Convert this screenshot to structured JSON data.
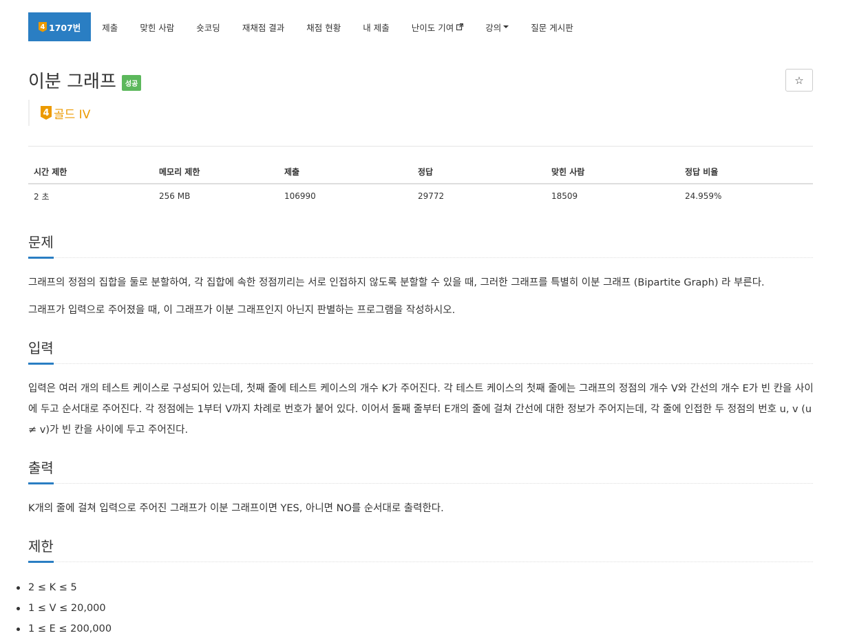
{
  "nav": {
    "problem_tier": "4",
    "problem_number": "1707번",
    "items": [
      {
        "label": "제출"
      },
      {
        "label": "맞힌 사람"
      },
      {
        "label": "숏코딩"
      },
      {
        "label": "재채점 결과"
      },
      {
        "label": "채점 현황"
      },
      {
        "label": "내 제출"
      },
      {
        "label": "난이도 기여"
      },
      {
        "label": "강의"
      },
      {
        "label": "질문 게시판"
      }
    ]
  },
  "problem": {
    "title": "이분 그래프",
    "status_badge": "성공",
    "star_icon": "☆",
    "tier_number": "4",
    "tier_label": "골드 IV"
  },
  "info_table": {
    "headers": [
      "시간 제한",
      "메모리 제한",
      "제출",
      "정답",
      "맞힌 사람",
      "정답 비율"
    ],
    "values": [
      "2 초",
      "256 MB",
      "106990",
      "29772",
      "18509",
      "24.959%"
    ]
  },
  "sections": {
    "description": {
      "title": "문제",
      "paragraphs": [
        "그래프의 정점의 집합을 둘로 분할하여, 각 집합에 속한 정점끼리는 서로 인접하지 않도록 분할할 수 있을 때, 그러한 그래프를 특별히 이분 그래프 (Bipartite Graph) 라 부른다.",
        "그래프가 입력으로 주어졌을 때, 이 그래프가 이분 그래프인지 아닌지 판별하는 프로그램을 작성하시오."
      ]
    },
    "input": {
      "title": "입력",
      "text": "입력은 여러 개의 테스트 케이스로 구성되어 있는데, 첫째 줄에 테스트 케이스의 개수 K가 주어진다. 각 테스트 케이스의 첫째 줄에는 그래프의 정점의 개수 V와 간선의 개수 E가 빈 칸을 사이에 두고 순서대로 주어진다. 각 정점에는 1부터 V까지 차례로 번호가 붙어 있다. 이어서 둘째 줄부터 E개의 줄에 걸쳐 간선에 대한 정보가 주어지는데, 각 줄에 인접한 두 정점의 번호 u, v (u ≠ v)가 빈 칸을 사이에 두고 주어진다."
    },
    "output": {
      "title": "출력",
      "text": "K개의 줄에 걸쳐 입력으로 주어진 그래프가 이분 그래프이면 YES, 아니면 NO를 순서대로 출력한다."
    },
    "limits": {
      "title": "제한",
      "items": [
        "2 ≤ K ≤ 5",
        "1 ≤ V ≤ 20,000",
        "1 ≤ E ≤ 200,000"
      ]
    }
  },
  "colors": {
    "primary": "#2a7ec3",
    "gold": "#ec9a00",
    "success": "#5cb85c"
  }
}
